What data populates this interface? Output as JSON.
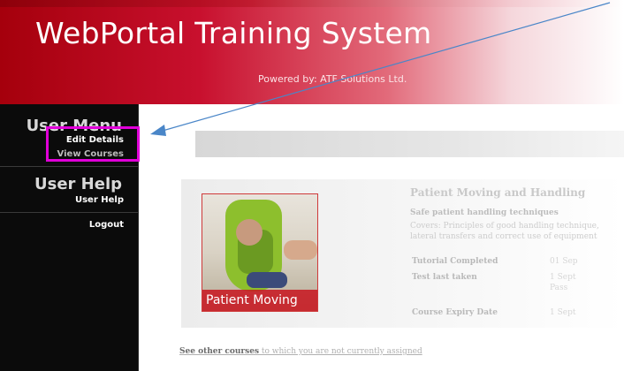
{
  "header": {
    "title": "WebPortal Training System",
    "powered_by": "Powered by: ATF Solutions Ltd."
  },
  "sidebar": {
    "user_menu_heading": "User Menu",
    "edit_details": "Edit Details",
    "view_courses": "View Courses",
    "user_help_heading": "User Help",
    "user_help_link": "User Help",
    "logout": "Logout"
  },
  "course": {
    "thumbnail_label": "Patient Moving",
    "title": "Patient Moving and Handling",
    "subtitle": "Safe patient handling techniques",
    "description_line1": "Covers: Principles of good handling technique,",
    "description_line2": "lateral transfers and correct use of equipment",
    "tutorial_label": "Tutorial Completed",
    "tutorial_value": "01 Sep",
    "test_label": "Test last taken",
    "test_value_1": "1 Sept",
    "test_value_2": "Pass",
    "expiry_label": "Course Expiry Date",
    "expiry_value": "1 Sept"
  },
  "footer": {
    "other_courses_link_bold": "See other courses",
    "other_courses_link_rest": " to which you are not currently assigned"
  },
  "colors": {
    "header_red": "#c8102e",
    "highlight_magenta": "#e000d8",
    "arrow_blue": "#4a86c8",
    "sidebar_bg": "#0b0b0b"
  }
}
